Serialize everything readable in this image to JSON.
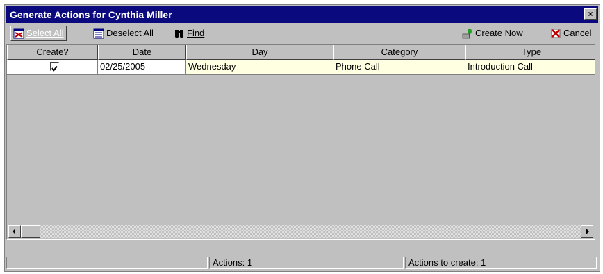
{
  "window": {
    "title": "Generate Actions for Cynthia Miller",
    "close_glyph": "×"
  },
  "toolbar": {
    "select_all": "Select All",
    "deselect_all": "Deselect All",
    "find": "Find",
    "create_now": "Create Now",
    "cancel": "Cancel"
  },
  "grid": {
    "columns": [
      "Create?",
      "Date",
      "Day",
      "Category",
      "Type"
    ],
    "rows": [
      {
        "create": true,
        "date": "02/25/2005",
        "day": "Wednesday",
        "category": "Phone Call",
        "type": "Introduction Call"
      }
    ]
  },
  "status": {
    "actions": "Actions: 1",
    "actions_to_create": "Actions to create: 1"
  },
  "colors": {
    "titlebar": "#0a0a7e",
    "row_highlight": "#ffffe1",
    "face": "#c0c0c0"
  },
  "icons": [
    "select-all-icon",
    "deselect-all-icon",
    "binoculars-icon",
    "create-now-icon",
    "cancel-icon",
    "close-icon",
    "checkbox-checked-icon",
    "scroll-left-icon",
    "scroll-right-icon"
  ]
}
